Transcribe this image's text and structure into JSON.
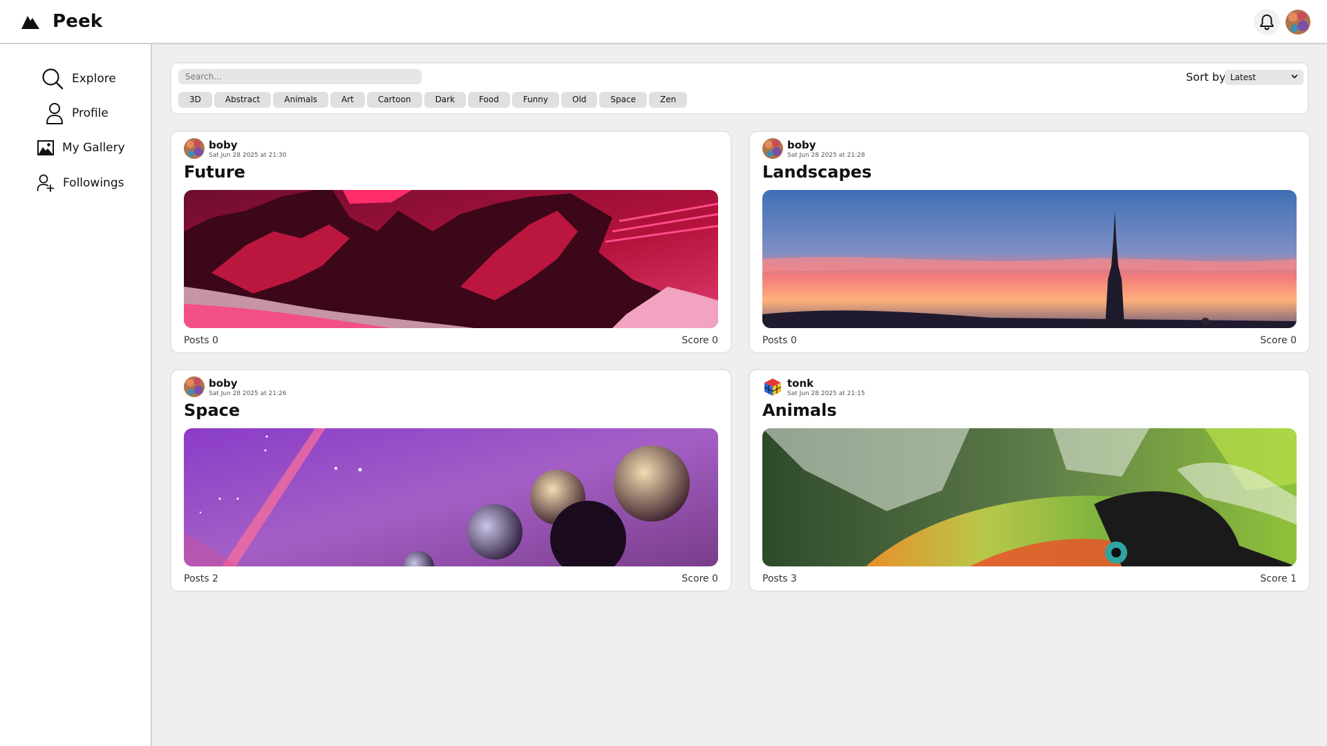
{
  "app": {
    "name": "Peek"
  },
  "sidebar": {
    "items": [
      {
        "label": "Explore",
        "icon": "search-icon"
      },
      {
        "label": "Profile",
        "icon": "user-icon"
      },
      {
        "label": "My Gallery",
        "icon": "image-icon"
      },
      {
        "label": "Followings",
        "icon": "user-plus-icon"
      }
    ]
  },
  "filters": {
    "search_placeholder": "Search...",
    "tags": [
      "3D",
      "Abstract",
      "Animals",
      "Art",
      "Cartoon",
      "Dark",
      "Food",
      "Funny",
      "Old",
      "Space",
      "Zen"
    ],
    "sort_label": "Sort by",
    "sort_value": "Latest"
  },
  "galleries": [
    {
      "user": "boby",
      "date": "Sat Jun 28 2025 at 21:30",
      "title": "Future",
      "posts": "Posts 0",
      "score": "Score 0",
      "image": "red-mountains-illustration"
    },
    {
      "user": "boby",
      "date": "Sat Jun 28 2025 at 21:28",
      "title": "Landscapes",
      "posts": "Posts 0",
      "score": "Score 0",
      "image": "sunset-church-spire"
    },
    {
      "user": "boby",
      "date": "Sat Jun 28 2025 at 21:26",
      "title": "Space",
      "posts": "Posts 2",
      "score": "Score 0",
      "image": "purple-planets"
    },
    {
      "user": "tonk",
      "date": "Sat Jun 28 2025 at 21:15",
      "title": "Animals",
      "posts": "Posts 3",
      "score": "Score 1",
      "image": "toucan-closeup"
    }
  ]
}
